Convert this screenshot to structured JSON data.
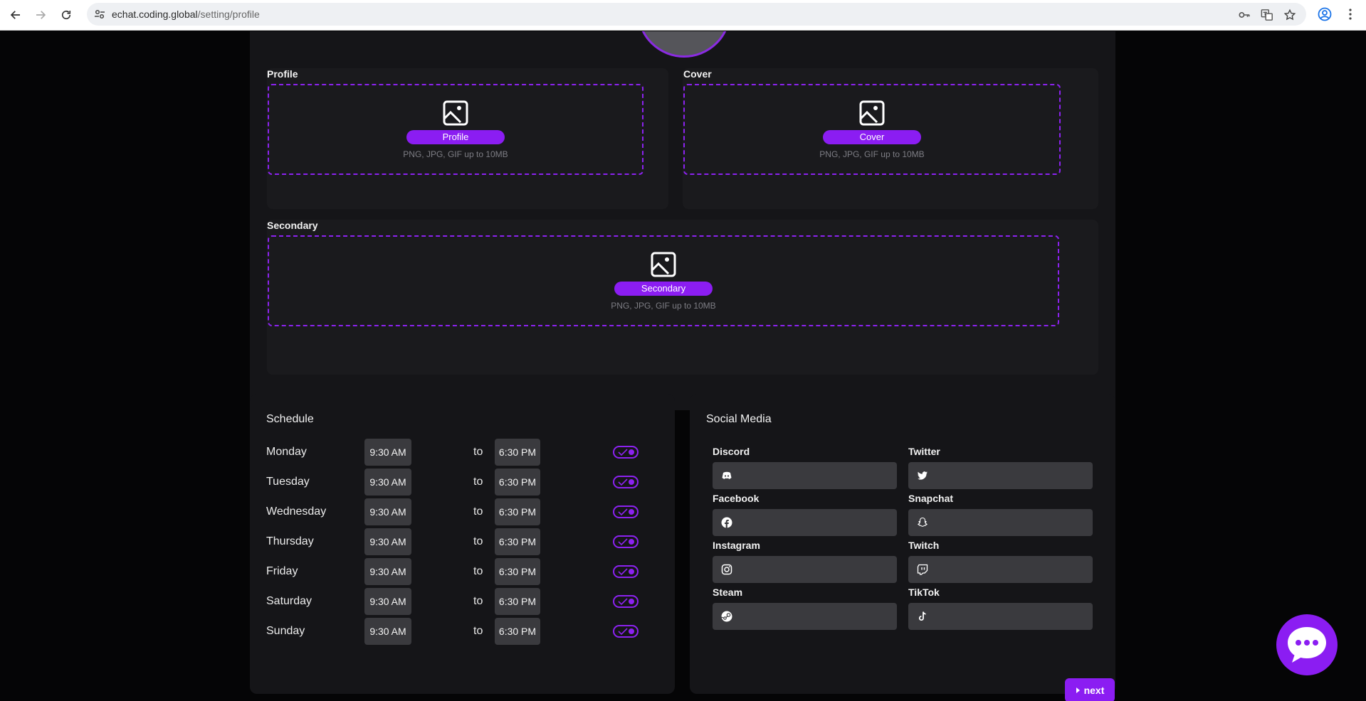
{
  "browser": {
    "url_host": "echat.coding.global",
    "url_path": "/setting/profile"
  },
  "uploads": {
    "profile": {
      "label": "Profile",
      "button": "Profile",
      "hint": "PNG, JPG, GIF up to 10MB"
    },
    "cover": {
      "label": "Cover",
      "button": "Cover",
      "hint": "PNG, JPG, GIF up to 10MB"
    },
    "secondary": {
      "label": "Secondary",
      "button": "Secondary",
      "hint": "PNG, JPG, GIF up to 10MB"
    }
  },
  "schedule": {
    "title": "Schedule",
    "to_label": "to",
    "days": [
      {
        "day": "Monday",
        "start": "9:30 AM",
        "end": "6:30 PM",
        "enabled": true
      },
      {
        "day": "Tuesday",
        "start": "9:30 AM",
        "end": "6:30 PM",
        "enabled": true
      },
      {
        "day": "Wednesday",
        "start": "9:30 AM",
        "end": "6:30 PM",
        "enabled": true
      },
      {
        "day": "Thursday",
        "start": "9:30 AM",
        "end": "6:30 PM",
        "enabled": true
      },
      {
        "day": "Friday",
        "start": "9:30 AM",
        "end": "6:30 PM",
        "enabled": true
      },
      {
        "day": "Saturday",
        "start": "9:30 AM",
        "end": "6:30 PM",
        "enabled": true
      },
      {
        "day": "Sunday",
        "start": "9:30 AM",
        "end": "6:30 PM",
        "enabled": true
      }
    ]
  },
  "social": {
    "title": "Social Media",
    "items": [
      {
        "label": "Discord",
        "icon": "discord-icon",
        "value": ""
      },
      {
        "label": "Twitter",
        "icon": "twitter-icon",
        "value": ""
      },
      {
        "label": "Facebook",
        "icon": "facebook-icon",
        "value": ""
      },
      {
        "label": "Snapchat",
        "icon": "snapchat-icon",
        "value": ""
      },
      {
        "label": "Instagram",
        "icon": "instagram-icon",
        "value": ""
      },
      {
        "label": "Twitch",
        "icon": "twitch-icon",
        "value": ""
      },
      {
        "label": "Steam",
        "icon": "steam-icon",
        "value": ""
      },
      {
        "label": "TikTok",
        "icon": "tiktok-icon",
        "value": ""
      }
    ]
  },
  "actions": {
    "next_label": "next"
  },
  "colors": {
    "accent": "#8b1df2",
    "panel": "#151518",
    "input": "#3a3a3e",
    "background": "#050506"
  }
}
